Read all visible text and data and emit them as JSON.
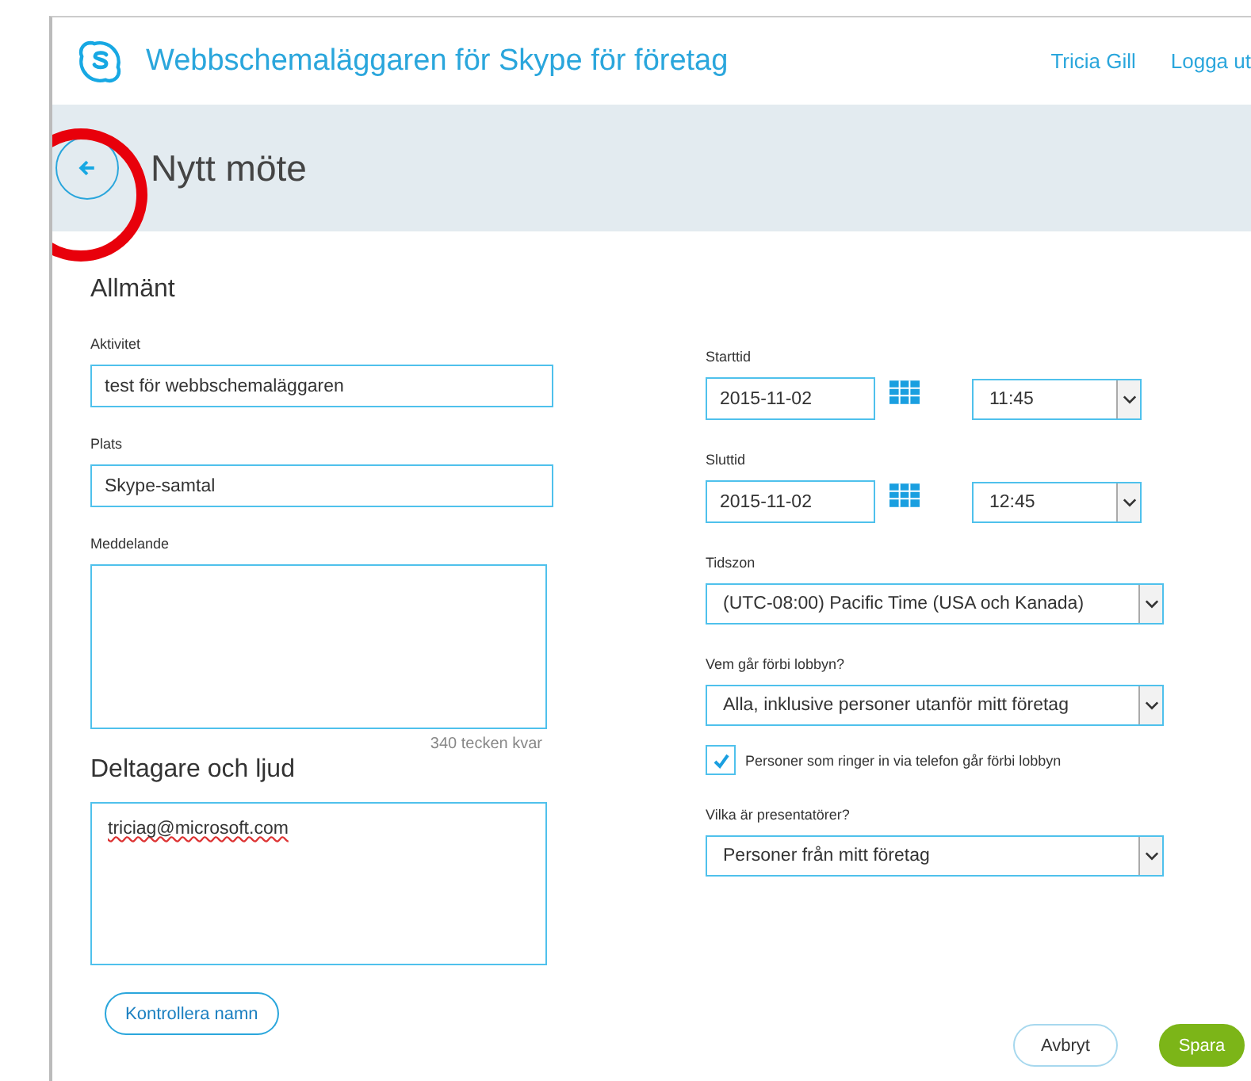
{
  "header": {
    "title": "Webbschemaläggaren för Skype för företag",
    "user": "Tricia Gill",
    "logout": "Logga ut"
  },
  "page": {
    "title": "Nytt möte"
  },
  "general": {
    "heading": "Allmänt",
    "activity": {
      "label": "Aktivitet",
      "value": "test för webbschemaläggaren"
    },
    "location": {
      "label": "Plats",
      "value": "Skype-samtal"
    },
    "message": {
      "label": "Meddelande",
      "counter": "340 tecken kvar"
    }
  },
  "participants": {
    "heading": "Deltagare och ljud",
    "value": "triciag@microsoft.com",
    "check_button": "Kontrollera namn"
  },
  "start": {
    "label": "Starttid",
    "date": "2015-11-02",
    "time": "11:45"
  },
  "end": {
    "label": "Sluttid",
    "date": "2015-11-02",
    "time": "12:45"
  },
  "timezone": {
    "label": "Tidszon",
    "value": "(UTC-08:00) Pacific Time (USA och Kanada)"
  },
  "lobby": {
    "label": "Vem går förbi lobbyn?",
    "value": "Alla, inklusive personer utanför mitt företag"
  },
  "phone_bypass": {
    "label": "Personer som ringer in via telefon går förbi lobbyn",
    "checked": true
  },
  "presenters": {
    "label": "Vilka är presentatörer?",
    "value": "Personer från mitt företag"
  },
  "buttons": {
    "cancel": "Avbryt",
    "save": "Spara"
  }
}
